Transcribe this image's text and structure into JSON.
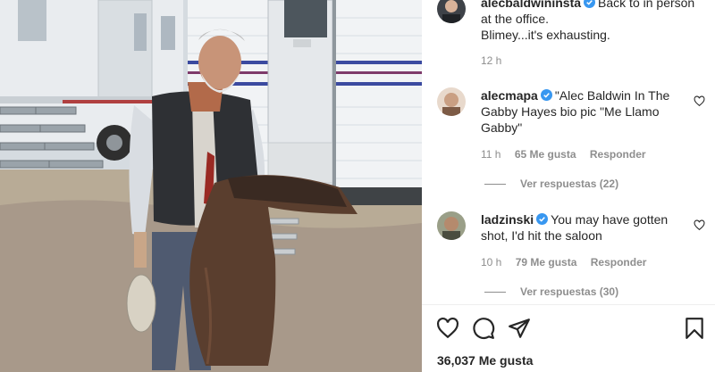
{
  "post": {
    "author": "alecbaldwininsta",
    "caption_line1": "Back to in person",
    "caption_line2": "at the office.",
    "caption_line3": "Blimey...it's exhausting.",
    "time": "12 h"
  },
  "comments": [
    {
      "username": "alecmapa",
      "text_line1": "\"Alec Baldwin In The",
      "text_line2": "Gabby Hayes bio pic \"Me Llamo",
      "text_line3": "Gabby\"",
      "time": "11 h",
      "likes": "65 Me gusta",
      "reply": "Responder",
      "view_replies": "Ver respuestas (22)"
    },
    {
      "username": "ladzinski",
      "text_line1": "You may have gotten",
      "text_line2": "shot, I'd hit the saloon",
      "time": "10 h",
      "likes": "79 Me gusta",
      "reply": "Responder",
      "view_replies": "Ver respuestas (30)"
    }
  ],
  "likes_count": "36,037 Me gusta",
  "icons": {
    "like": "heart-icon",
    "comment": "comment-icon",
    "share": "share-icon",
    "save": "bookmark-icon",
    "verified": "verified-badge-icon"
  },
  "colors": {
    "verified": "#3897f0",
    "secondary_text": "#8e8e8e",
    "primary_text": "#262626"
  }
}
